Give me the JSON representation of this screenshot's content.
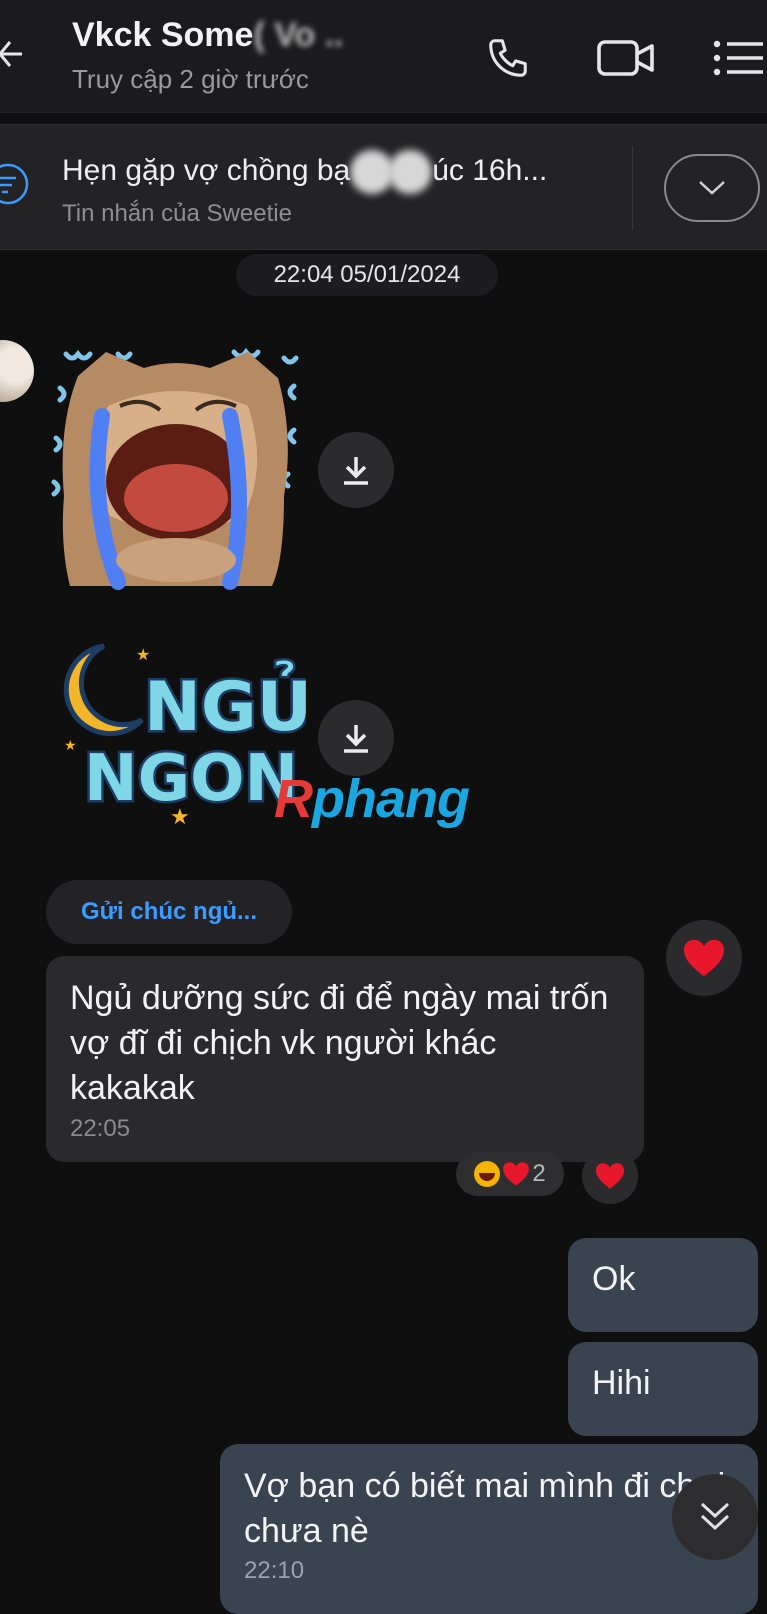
{
  "header": {
    "title": "Vkck Some",
    "title_blurred": "( Vo ..",
    "subtitle": "Truy cập 2 giờ trước"
  },
  "pinned": {
    "text_before": "Hẹn gặp vợ chồng bạ",
    "text_after": "úc 16h...",
    "sub": "Tin nhắn của Sweetie"
  },
  "chat": {
    "date": "22:04 05/01/2024",
    "quote": "Gửi chúc ngủ...",
    "incoming": {
      "text": "Ngủ dưỡng sức đi để ngày mai trốn vợ đĩ đi chịch vk người khác kakakak",
      "time": "22:05",
      "reaction_count": "2"
    },
    "outgoing": [
      {
        "text": "Ok"
      },
      {
        "text": "Hihi"
      },
      {
        "text": "Vợ bạn có biết mai mình đi chơi chưa nè",
        "time": "22:10"
      }
    ]
  },
  "sticker_text": {
    "line1": "NGỦ",
    "line2": "NGON"
  },
  "watermark": {
    "r": "R",
    "rest": "phang"
  },
  "icons": {
    "back": "back-arrow-icon",
    "call": "phone-icon",
    "video": "video-camera-icon",
    "menu": "list-menu-icon",
    "pinned": "pin-list-icon",
    "expand": "chevron-down-icon",
    "download": "download-icon",
    "heart": "heart-icon",
    "scroll": "double-chevron-down-icon"
  },
  "colors": {
    "background": "#0f0f10",
    "outgoing_bubble": "#3a4350",
    "incoming_bubble": "#2a2a2c",
    "accent": "#3d9bff",
    "heart": "#e8172b"
  }
}
